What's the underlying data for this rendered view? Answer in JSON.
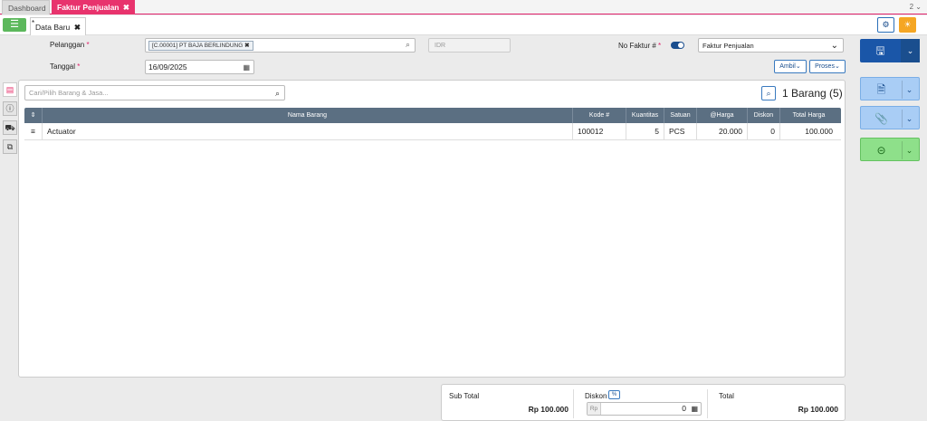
{
  "tabs": {
    "dashboard": "Dashboard",
    "active": "Faktur Penjualan",
    "close_glyph": "✖",
    "window_count": "2",
    "window_chevron": "⌄"
  },
  "subtab": {
    "label": "Data Baru",
    "marker": "*",
    "close_glyph": "✖"
  },
  "form": {
    "customer_label": "Pelanggan",
    "customer_chip": "[C.00001] PT BAJA BERLINDUNG",
    "currency_placeholder": "IDR",
    "invoice_no_label": "No Faktur #",
    "invoice_type": "Faktur Penjualan",
    "date_label": "Tanggal",
    "date_value": "16/09/2025",
    "required_mark": "*",
    "ambil_button": "Ambil",
    "proses_button": "Proses",
    "chevron": "⌄"
  },
  "items": {
    "search_placeholder": "Cari/Pilih Barang & Jasa...",
    "count_label": "1 Barang (5)",
    "columns": [
      "",
      "Nama Barang",
      "Kode #",
      "Kuantitas",
      "Satuan",
      "@Harga",
      "Diskon",
      "Total Harga"
    ],
    "sort_glyph": "⇕",
    "rows": [
      {
        "handle": "≡",
        "name": "Actuator",
        "code": "100012",
        "qty": "5",
        "unit": "PCS",
        "price": "20.000",
        "discount": "0",
        "total": "100.000"
      }
    ]
  },
  "totals": {
    "subtotal_label": "Sub Total",
    "subtotal_value": "Rp 100.000",
    "discount_label": "Diskon",
    "discount_pct_button": "%",
    "discount_currency": "Rp",
    "discount_value": "0",
    "total_label": "Total",
    "total_value": "Rp 100.000"
  },
  "icons": {
    "list": "list-icon",
    "gear": "gear-icon",
    "bulb": "lightbulb-icon",
    "save": "save-icon",
    "document": "document-icon",
    "attachment": "paperclip-icon",
    "more": "more-icon"
  },
  "colors": {
    "accent_pink": "#e8336d",
    "primary_blue": "#1a56a8",
    "success_green": "#5cb85c",
    "warning_orange": "#f5a623",
    "grid_header": "#5b6f82"
  }
}
